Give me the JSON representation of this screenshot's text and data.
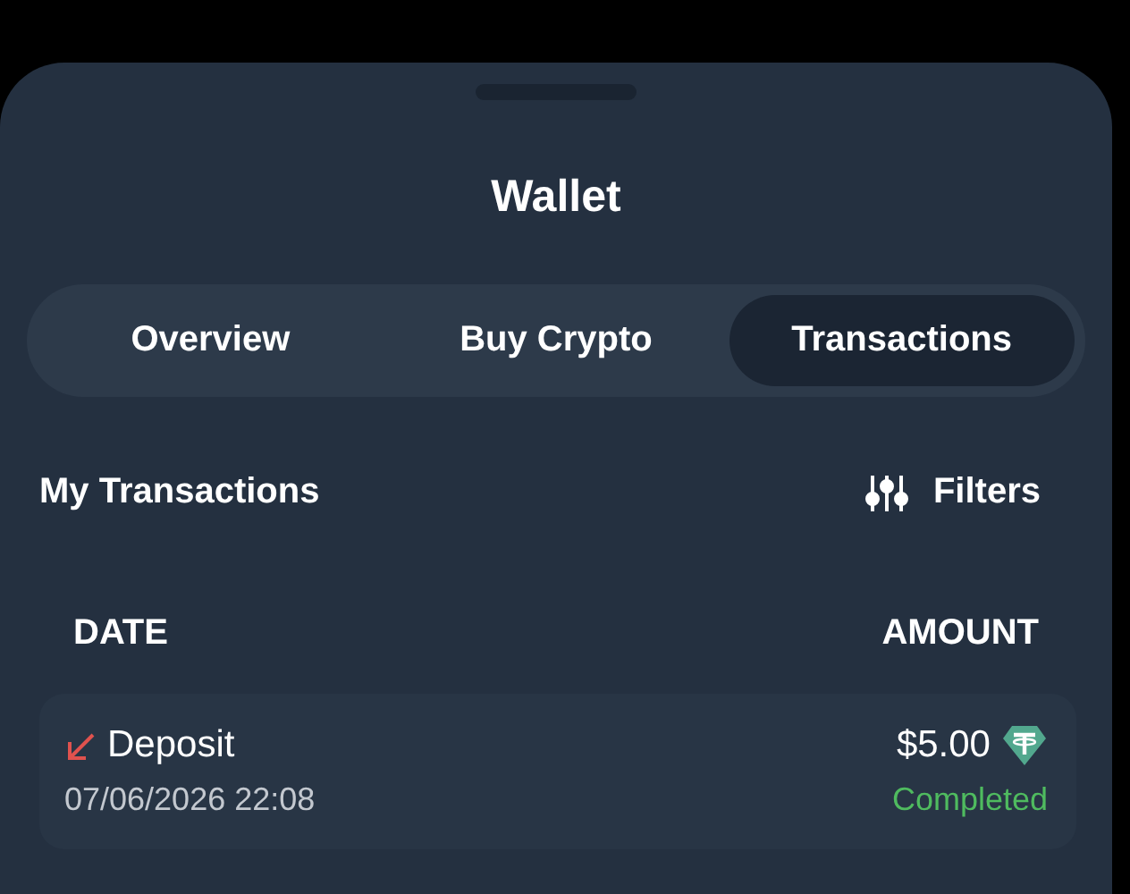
{
  "sheet": {
    "title": "Wallet"
  },
  "tabs": [
    {
      "label": "Overview",
      "selected": false
    },
    {
      "label": "Buy Crypto",
      "selected": false
    },
    {
      "label": "Transactions",
      "selected": true
    }
  ],
  "section": {
    "title": "My Transactions",
    "filter_button": "Filters"
  },
  "table": {
    "columns": [
      "DATE",
      "AMOUNT"
    ],
    "rows": [
      {
        "kind": "deposit",
        "type": "Deposit",
        "date": "07/06/2026 22:08",
        "amount": "$5.00",
        "status": "Completed",
        "completed": true
      }
    ]
  }
}
